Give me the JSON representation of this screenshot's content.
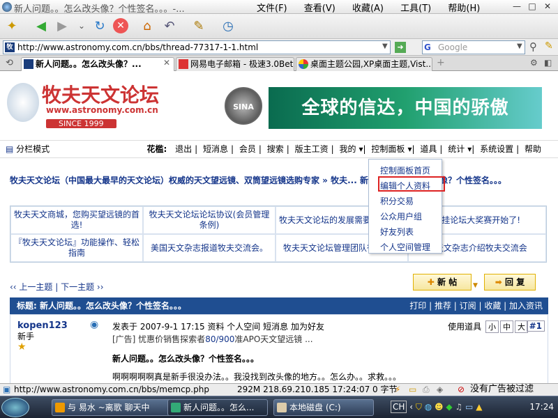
{
  "window": {
    "title": "新人问题。。怎么改头像？个性签名。。。-...",
    "menu": [
      "文件(F)",
      "查看(V)",
      "收藏(A)",
      "工具(T)",
      "帮助(H)"
    ]
  },
  "address": {
    "url": "http://www.astronomy.com.cn/bbs/thread-77317-1-1.html",
    "search_placeholder": "Google"
  },
  "tabs": [
    {
      "label": "新人问题。。怎么改头像？..."
    },
    {
      "label": "网易电子邮箱 - 极速3.0Beta"
    },
    {
      "label": "桌面主题公园,XP桌面主题,Vist..."
    }
  ],
  "site": {
    "logo_text": "牧夫天文论坛",
    "logo_url": "www.astronomy.com.cn",
    "since": "SINCE 1999",
    "badge": "SINA",
    "banner": "全球的信达，中国的骄傲"
  },
  "nav": {
    "view_mode": "分栏模式",
    "user": "花槛:",
    "items": [
      "退出",
      "短消息",
      "会员",
      "搜索",
      "版主工资",
      "我的",
      "控制面板",
      "道具",
      "统计",
      "系统设置",
      "帮助"
    ]
  },
  "breadcrumb": "牧夫天文论坛（中国最大最早的天文论坛）权威的天文望远镜、双筒望远镜选购专家 » 牧夫... 新人问题。。怎么改头像？个性签名。。。",
  "links": [
    "牧夫天文商城，您购买望远镜的首选!",
    "牧夫天文论坛论坛协议(会员管理条例)",
    "牧夫天文论坛的发展需要您的支持",
    "...挂论坛大奖赛开始了!",
    "『牧夫天文论坛』功能操作、轻松指南",
    "美国天文杂志报道牧夫交流会。",
    "牧夫天文论坛管理团队征招启事",
    "...天文杂志介绍牧夫交流会"
  ],
  "pagenav": "‹‹ 上一主题 | 下一主题 ››",
  "buttons": {
    "new_post": "新 帖",
    "reply": "回 复"
  },
  "thread": {
    "title": "标题: 新人问题。。怎么改头像？个性签名。。。",
    "actions": "打印 | 推荐 | 订阅 | 收藏 | 加入资讯"
  },
  "post": {
    "author": "kopen123",
    "role": "新手",
    "meta": "发表于  2007-9-1 17:15  资料  个人空间  短消息  加为好友",
    "ad_prefix": "[广告] 忧惠价销售探索者",
    "ad_link": "80/900",
    "ad_suffix": "准APO天文望远镜 ...",
    "tools": "使用道具",
    "sizes": [
      "小",
      "中",
      "大"
    ],
    "floor": "#1",
    "title": "新人问题。。怎么改头像？个性签名。。。",
    "body": "啊啊啊啊啊真是新手很没办法。。我没找到改头像的地方。。怎么办。。求救。。。"
  },
  "dropdown": {
    "items": [
      "控制面板首页",
      "编辑个人资料",
      "积分交易",
      "公众用户组",
      "好友列表",
      "个人空间管理"
    ],
    "highlighted": "编辑个人资料"
  },
  "statusbar": {
    "url": "http://www.astronomy.com.cn/bbs/memcp.php",
    "info": "292M 218.69.210.185 17:24:07 0 字节",
    "adblock": "没有广告被过滤"
  },
  "taskbar": {
    "tasks": [
      "与 易水 ~离歌 聊天中",
      "新人问题。。怎么...",
      "本地磁盘 (C:)"
    ],
    "ime": "CH",
    "clock": "17:24"
  }
}
